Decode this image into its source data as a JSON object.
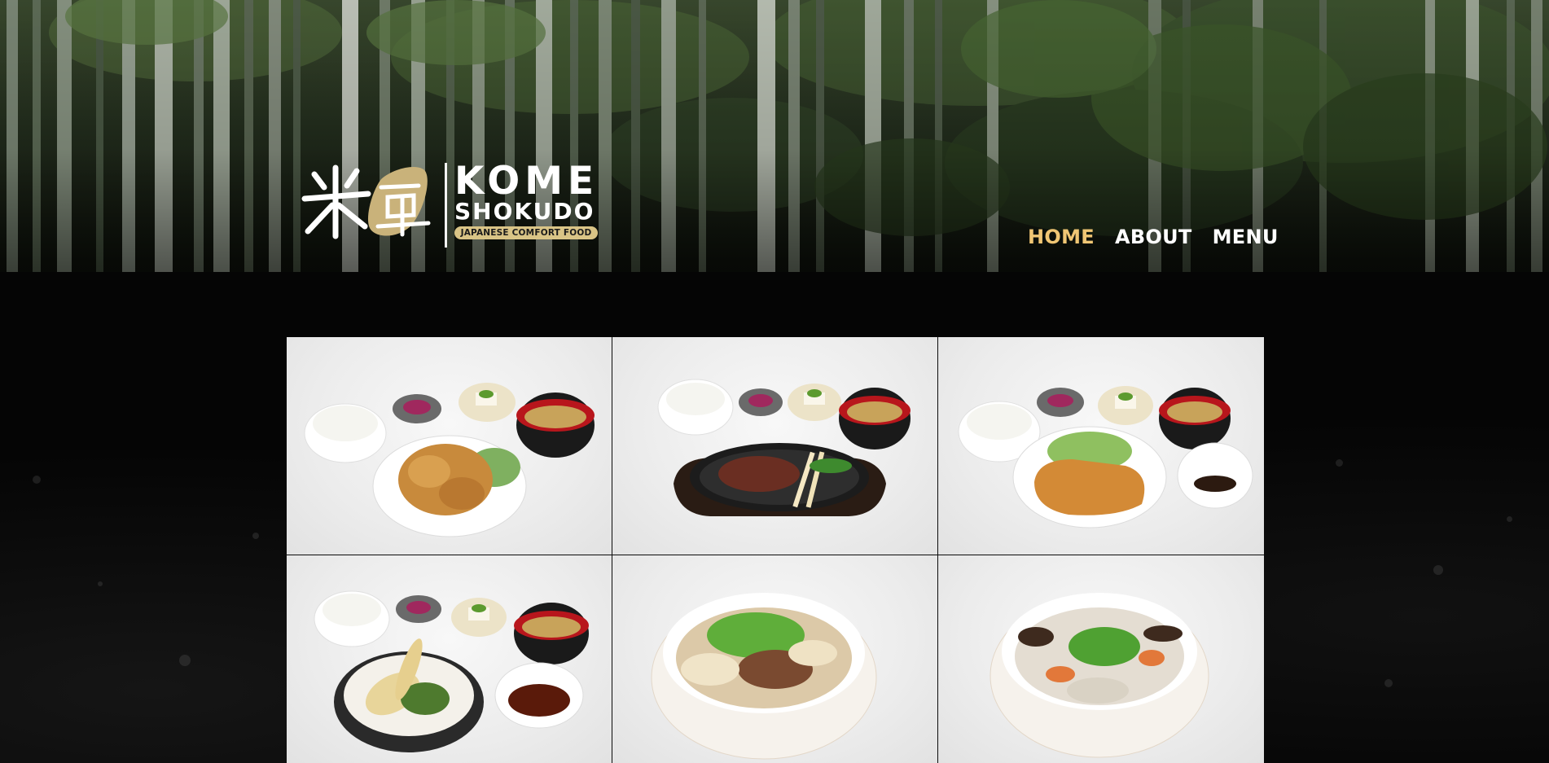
{
  "brand": {
    "name_line1": "KOME",
    "name_line2": "SHOKUDO",
    "tagline": "JAPANESE COMFORT FOOD",
    "logo_mark": "kanji-logo-mark"
  },
  "nav": {
    "items": [
      {
        "label": "HOME",
        "active": true
      },
      {
        "label": "ABOUT",
        "active": false
      },
      {
        "label": "MENU",
        "active": false
      }
    ]
  },
  "colors": {
    "nav_active": "#f0c674",
    "nav_default": "#ffffff",
    "tag_gold": "#d9c486",
    "page_bg": "#050505"
  },
  "gallery": {
    "images": [
      {
        "name": "karaage-set-photo"
      },
      {
        "name": "steak-set-photo"
      },
      {
        "name": "tonkatsu-set-photo"
      },
      {
        "name": "tempura-set-photo"
      },
      {
        "name": "beef-udon-photo"
      },
      {
        "name": "tonjiru-soup-photo"
      }
    ]
  }
}
